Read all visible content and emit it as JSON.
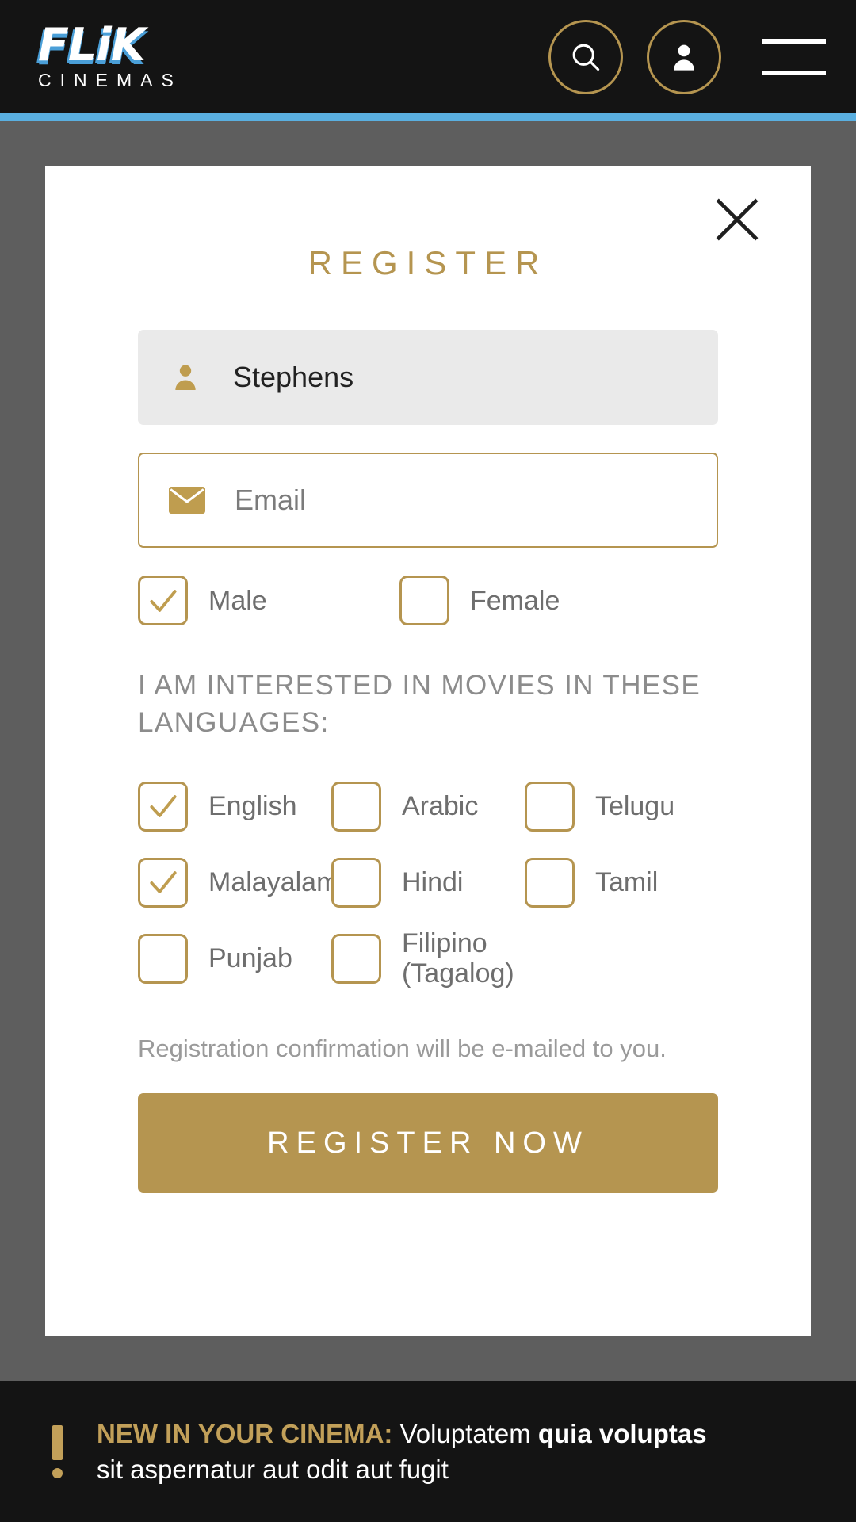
{
  "header": {
    "logo_main": "FLiK",
    "logo_sub": "CINEMAS",
    "search_icon": "search-icon",
    "account_icon": "user-account-icon",
    "menu_icon": "hamburger-menu-icon",
    "accent_gold": "#b59550",
    "accent_blue": "#5aafe0",
    "background": "#141414"
  },
  "modal": {
    "title": "REGISTER",
    "close_label": "close-icon",
    "name_field": {
      "icon": "person-icon",
      "value": "Stephens",
      "placeholder": "Name"
    },
    "email_field": {
      "icon": "envelope-icon",
      "value": "",
      "placeholder": "Email"
    },
    "gender": [
      {
        "label": "Male",
        "checked": true
      },
      {
        "label": "Female",
        "checked": false
      }
    ],
    "interests_title": "I AM INTERESTED IN MOVIES IN THESE LANGUAGES:",
    "languages": [
      {
        "label": "English",
        "checked": true
      },
      {
        "label": "Arabic",
        "checked": false
      },
      {
        "label": "Telugu",
        "checked": false
      },
      {
        "label": "Malayalam",
        "checked": true
      },
      {
        "label": "Hindi",
        "checked": false
      },
      {
        "label": "Tamil",
        "checked": false
      },
      {
        "label": "Punjab",
        "checked": false
      },
      {
        "label": "Filipino (Tagalog)",
        "checked": false
      }
    ],
    "note": "Registration confirmation will be e-mailed to you.",
    "submit_label": "REGISTER NOW"
  },
  "banner": {
    "icon": "exclamation-icon",
    "prefix": "NEW IN YOUR CINEMA:",
    "text_1": " Voluptatem ",
    "text_bold": "quia voluptas",
    "text_2": "sit aspernatur aut odit aut fugit"
  }
}
